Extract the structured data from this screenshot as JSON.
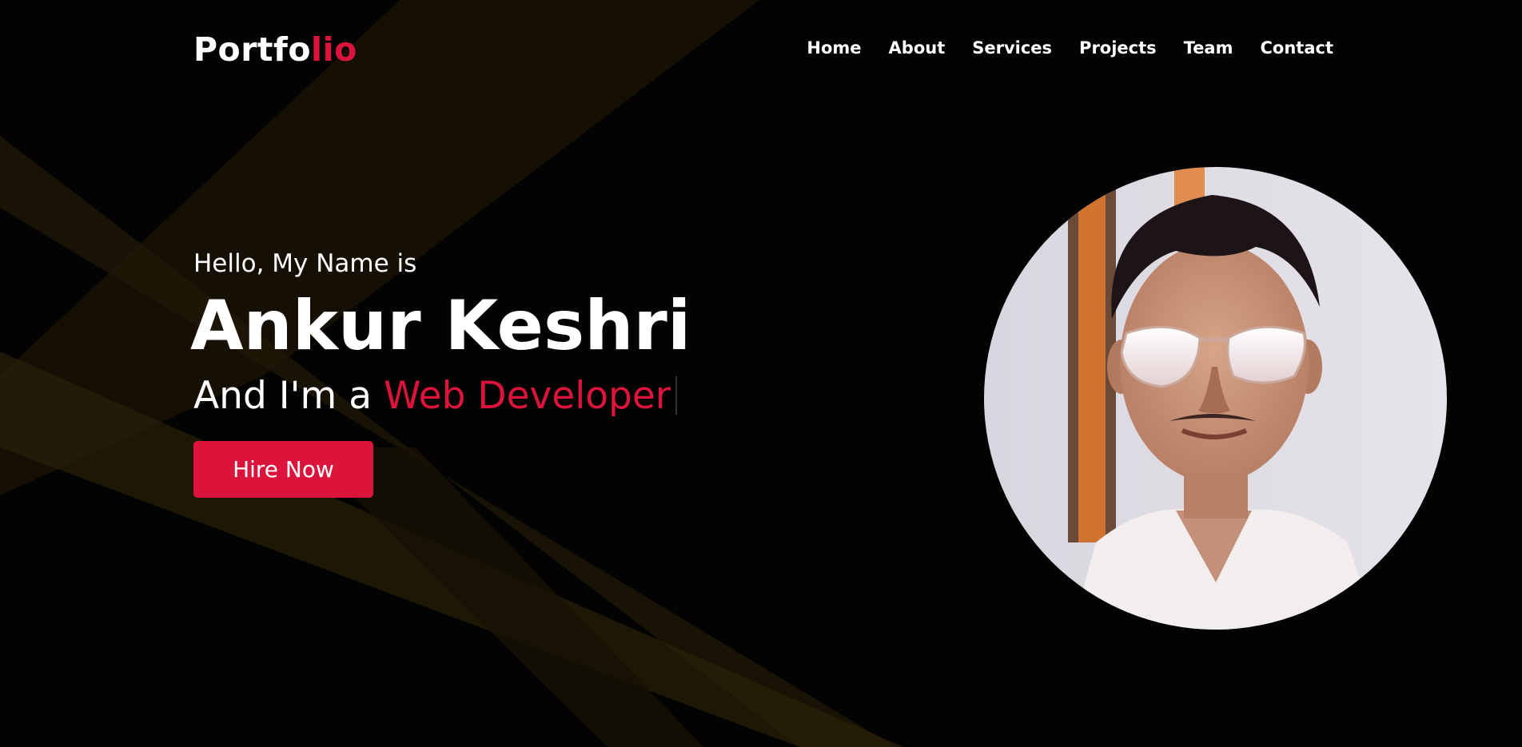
{
  "brand": {
    "logo_main": "Portfo",
    "logo_accent": "lio",
    "accent_color": "#dc143c"
  },
  "nav": {
    "items": [
      "Home",
      "About",
      "Services",
      "Projects",
      "Team",
      "Contact"
    ]
  },
  "hero": {
    "greeting": "Hello, My Name is",
    "name": "Ankur Keshri",
    "role_prefix": "And I'm a ",
    "role_typed": "Web Developer",
    "cta_label": "Hire Now"
  },
  "profile": {
    "image_name": "profile-photo"
  }
}
